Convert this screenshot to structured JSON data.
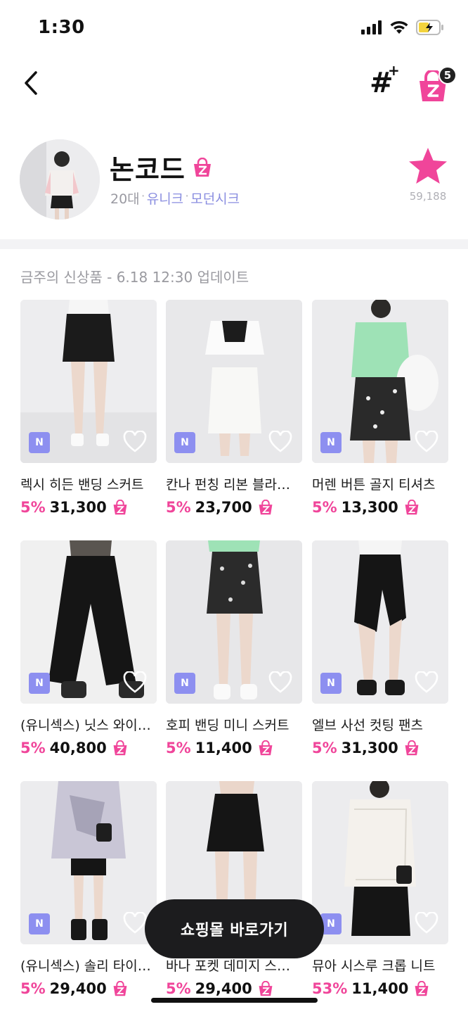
{
  "status": {
    "time": "1:30"
  },
  "nav": {
    "cart_count": "5",
    "icons": [
      "back-chevron",
      "hashtag-plus",
      "zigzag-cart"
    ]
  },
  "profile": {
    "shop_name": "논코드",
    "age": "20대",
    "tags": [
      "유니크",
      "모던시크"
    ],
    "favorites": "59,188"
  },
  "section": {
    "title": "금주의 신상품 - 6.18 12:30 업데이트"
  },
  "products": [
    {
      "name": "렉시 히든 밴딩 스커트",
      "discount": "5%",
      "price": "31,300",
      "badge": "N"
    },
    {
      "name": "칸나 펀칭 리본 블라…",
      "discount": "5%",
      "price": "23,700",
      "badge": "N"
    },
    {
      "name": "머렌 버튼 골지 티셔츠",
      "discount": "5%",
      "price": "13,300",
      "badge": "N"
    },
    {
      "name": "(유니섹스) 닛스 와이…",
      "discount": "5%",
      "price": "40,800",
      "badge": "N"
    },
    {
      "name": "호피 밴딩 미니 스커트",
      "discount": "5%",
      "price": "11,400",
      "badge": "N"
    },
    {
      "name": "엘브 사선 컷팅 팬츠",
      "discount": "5%",
      "price": "31,300",
      "badge": "N"
    },
    {
      "name": "(유니섹스) 솔리 타이…",
      "discount": "5%",
      "price": "29,400",
      "badge": "N"
    },
    {
      "name": "바나 포켓 데미지 스…",
      "discount": "5%",
      "price": "29,400",
      "badge": ""
    },
    {
      "name": "뮤아 시스루 크롭 니트",
      "discount": "53%",
      "price": "11,400",
      "badge": "N"
    }
  ],
  "cta": {
    "label": "쇼핑몰 바로가기"
  },
  "colors": {
    "accent": "#f0459a",
    "badge": "#8d8ff0",
    "tag": "#8a8ee0",
    "cta_bg": "#1c1c1e"
  }
}
